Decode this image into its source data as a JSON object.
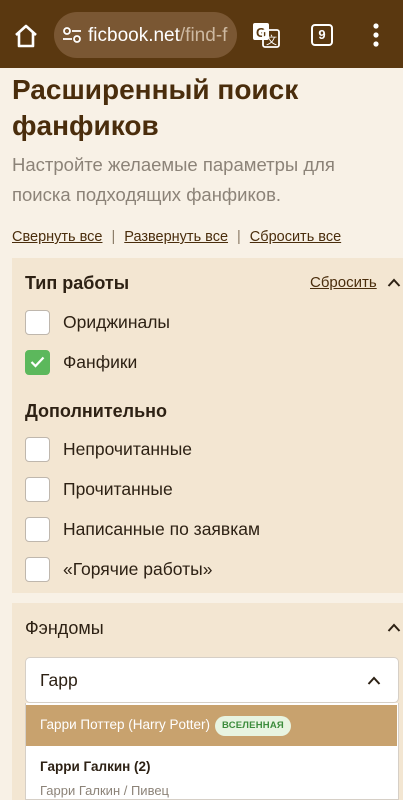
{
  "browser": {
    "url_host": "ficbook.net",
    "url_path": "/find-f",
    "tab_count": "9",
    "icons": [
      "home-icon",
      "site-settings-icon",
      "translate-icon",
      "more-vert-icon"
    ]
  },
  "header": {
    "title": "Расширенный поиск фанфиков",
    "subtitle": "Настройте желаемые параметры для поиска подходящих фанфиков."
  },
  "controls": {
    "collapse_all": "Свернуть все",
    "expand_all": "Развернуть все",
    "reset_all": "Сбросить все",
    "separator": "|"
  },
  "work_type": {
    "title": "Тип работы",
    "reset": "Сбросить",
    "options": [
      {
        "label": "Ориджиналы",
        "checked": false
      },
      {
        "label": "Фанфики",
        "checked": true
      }
    ]
  },
  "additional": {
    "title": "Дополнительно",
    "options": [
      {
        "label": "Непрочитанные",
        "checked": false
      },
      {
        "label": "Прочитанные",
        "checked": false
      },
      {
        "label": "Написанные по заявкам",
        "checked": false
      },
      {
        "label": "«Горячие работы»",
        "checked": false
      }
    ]
  },
  "fandoms": {
    "title": "Фэндомы",
    "input_value": "Гарр",
    "results": [
      {
        "name": "Гарри Поттер (Harry Potter)",
        "badge": "ВСЕЛЕННАЯ",
        "highlighted": true
      },
      {
        "name": "Гарри Галкин (2)",
        "subtitle": "Гарри Галкин / Пивец"
      }
    ]
  },
  "colors": {
    "chrome": "#5a3810",
    "title": "#4a2d0c",
    "card_bg": "#f3e6d2",
    "checkbox_checked": "#5cb85c",
    "highlight": "#c8a26e"
  }
}
